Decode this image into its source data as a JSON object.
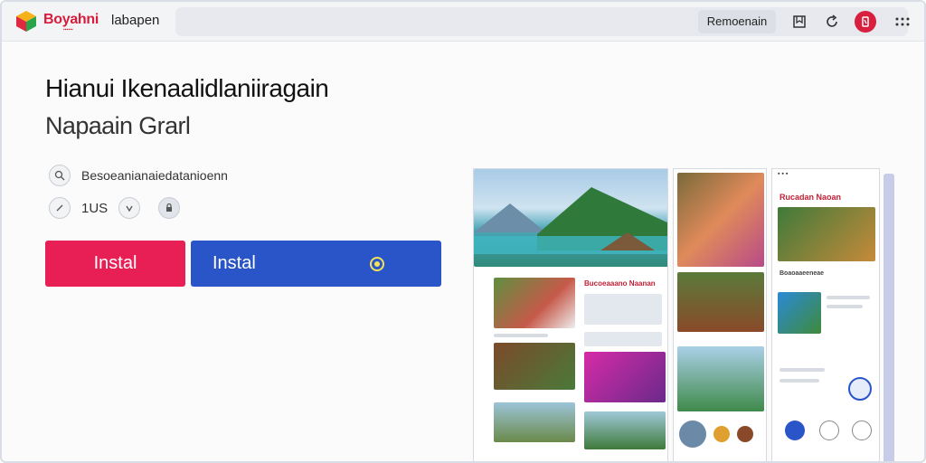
{
  "header": {
    "brand": "Boyahni",
    "tab_label": "labapen",
    "action_button": "Remoenain"
  },
  "app": {
    "title": "Hianui Ikenaalidlaniiragain",
    "developer": "Napaain Grarl",
    "description_line": "Besoeanianaiedatanioenn",
    "rating_text": "1US",
    "install_primary": "Instal",
    "install_secondary": "Instal"
  },
  "screenshots": {
    "card_title_1": "Rucadan Naoan",
    "card_title_2": "Bucoeaaano Naanan",
    "card_title_3": "Boaoaaeeneae"
  },
  "colors": {
    "accent_red": "#e81f55",
    "accent_blue": "#2a55c9",
    "brand_red": "#d61e3c"
  },
  "icons": {
    "logo": "multicolor-cube-icon",
    "bookmark": "bookmark-icon",
    "refresh": "refresh-icon",
    "menu": "menu-icon",
    "search": "search-icon",
    "share": "share-icon",
    "check": "check-icon",
    "sparkle": "sparkle-icon"
  }
}
